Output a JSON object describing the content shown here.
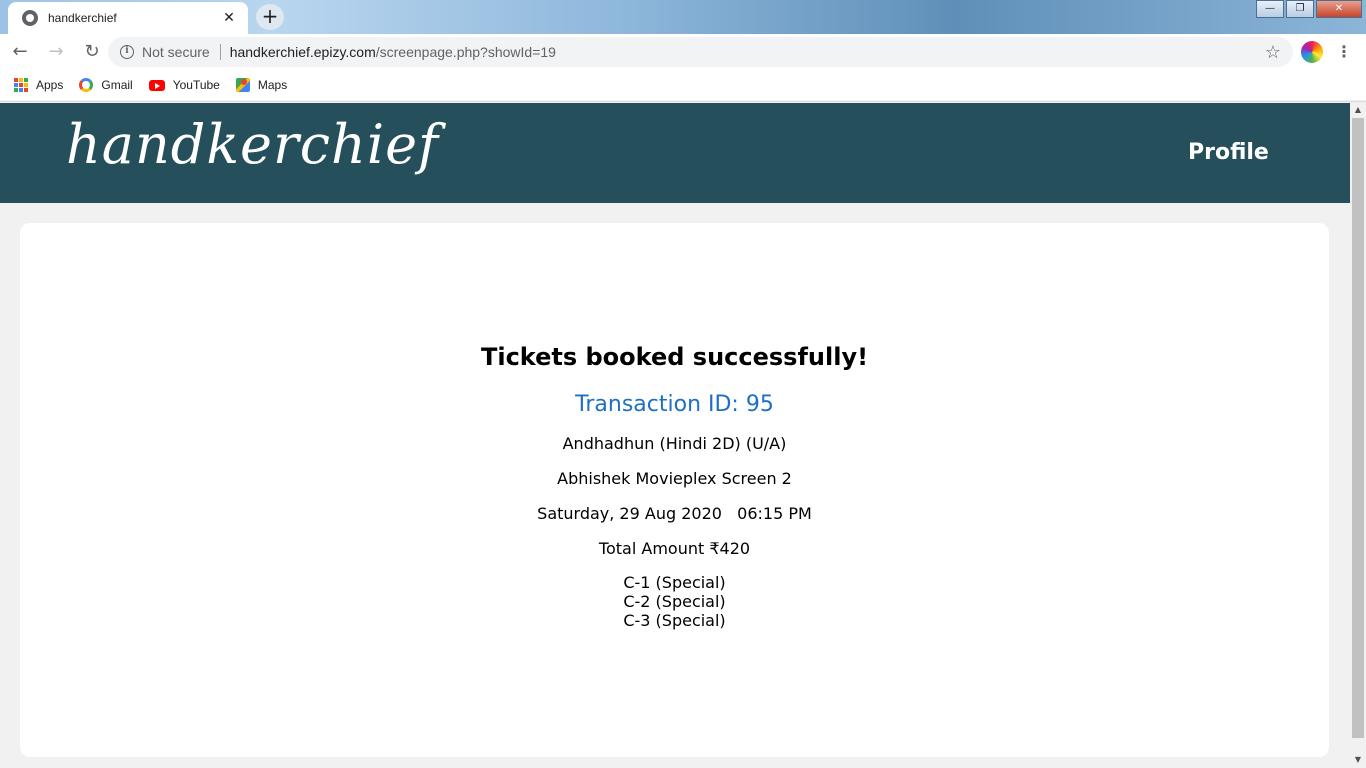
{
  "browser": {
    "tab_title": "handkerchief",
    "tab_close": "✕",
    "new_tab": "+",
    "back": "←",
    "forward": "→",
    "reload": "↻",
    "security_label": "Not secure",
    "url_host": "handkerchief.epizy.com",
    "url_path": "/screenpage.php?showId=19",
    "star": "☆",
    "menu": "⋮",
    "window_minimize": "—",
    "window_restore": "❐",
    "window_close": "✕",
    "bookmarks": [
      {
        "label": "Apps",
        "icon": "apps-icon"
      },
      {
        "label": "Gmail",
        "icon": "google-icon"
      },
      {
        "label": "YouTube",
        "icon": "youtube-icon"
      },
      {
        "label": "Maps",
        "icon": "maps-icon"
      }
    ]
  },
  "site": {
    "logo": "handkerchief",
    "nav_profile": "Profile",
    "header_color": "#254f5a"
  },
  "booking": {
    "title": "Tickets booked successfully!",
    "transaction": "Transaction ID: 95",
    "movie": "Andhadhun (Hindi 2D) (U/A)",
    "venue": "Abhishek Movieplex Screen 2",
    "datetime": "Saturday, 29 Aug 2020   06:15 PM",
    "total": "Total Amount ₹420",
    "seats": [
      "C-1 (Special)",
      "C-2 (Special)",
      "C-3 (Special)"
    ],
    "accent_color": "#1f6fc5"
  }
}
